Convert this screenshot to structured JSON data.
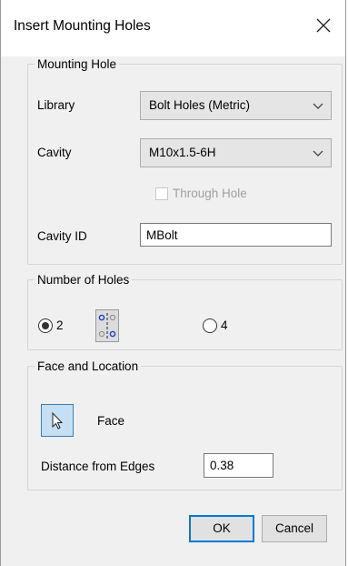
{
  "window": {
    "title": "Insert Mounting Holes",
    "close_symbol": "✕"
  },
  "mounting_hole": {
    "legend": "Mounting Hole",
    "library_label": "Library",
    "library_value": "Bolt Holes (Metric)",
    "cavity_label": "Cavity",
    "cavity_value": "M10x1.5-6H",
    "through_hole_label": "Through Hole",
    "through_hole_checked": false,
    "through_hole_enabled": false,
    "cavity_id_label": "Cavity ID",
    "cavity_id_value": "MBolt"
  },
  "number_of_holes": {
    "legend": "Number of Holes",
    "options": [
      {
        "label": "2",
        "selected": true,
        "icon": "two-hole-pattern-icon"
      },
      {
        "label": "4",
        "selected": false
      }
    ]
  },
  "face_location": {
    "legend": "Face and Location",
    "face_button_icon": "cursor-arrow-icon",
    "face_label": "Face",
    "distance_label": "Distance from Edges",
    "distance_value": "0.38"
  },
  "buttons": {
    "ok": "OK",
    "cancel": "Cancel"
  },
  "colors": {
    "accent": "#0078d7",
    "hole_marker": "#1f3fd6",
    "selected_button_fill": "#c5e0f5"
  }
}
